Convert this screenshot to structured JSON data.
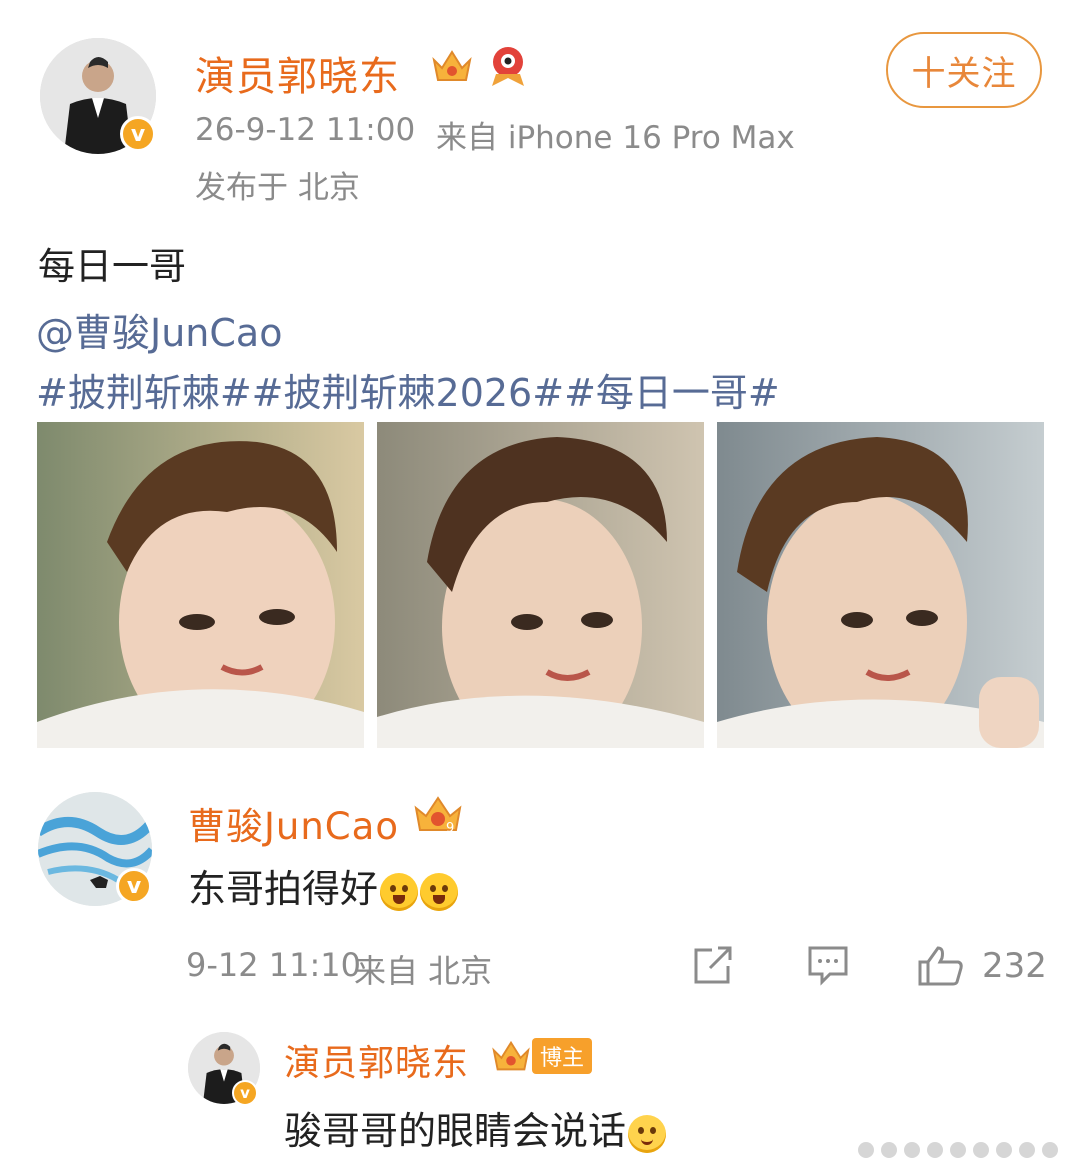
{
  "post": {
    "author": "演员郭晓东",
    "time": "26-9-12 11:00",
    "source": "来自 iPhone 16 Pro Max",
    "location": "发布于 北京",
    "follow_label": "十关注",
    "text": "每日一哥",
    "mention": "@曹骏JunCao",
    "hashtags": "#披荆斩棘##披荆斩棘2026##每日一哥#"
  },
  "comment": {
    "author": "曹骏JunCao",
    "text": "东哥拍得好",
    "time": "9-12 11:10",
    "location": "来自 北京",
    "like_count": "232"
  },
  "reply": {
    "author": "演员郭晓东",
    "badge": "博主",
    "text": "骏哥哥的眼睛会说话"
  },
  "colors": {
    "username": "#e86a1c",
    "link": "#576b95",
    "meta": "#8b8b8b",
    "badge": "#f5a623"
  },
  "icons": [
    "crown-icon",
    "weibo-mascot-icon",
    "verified-icon",
    "share-icon",
    "comment-icon",
    "like-icon",
    "emoji-icon"
  ]
}
